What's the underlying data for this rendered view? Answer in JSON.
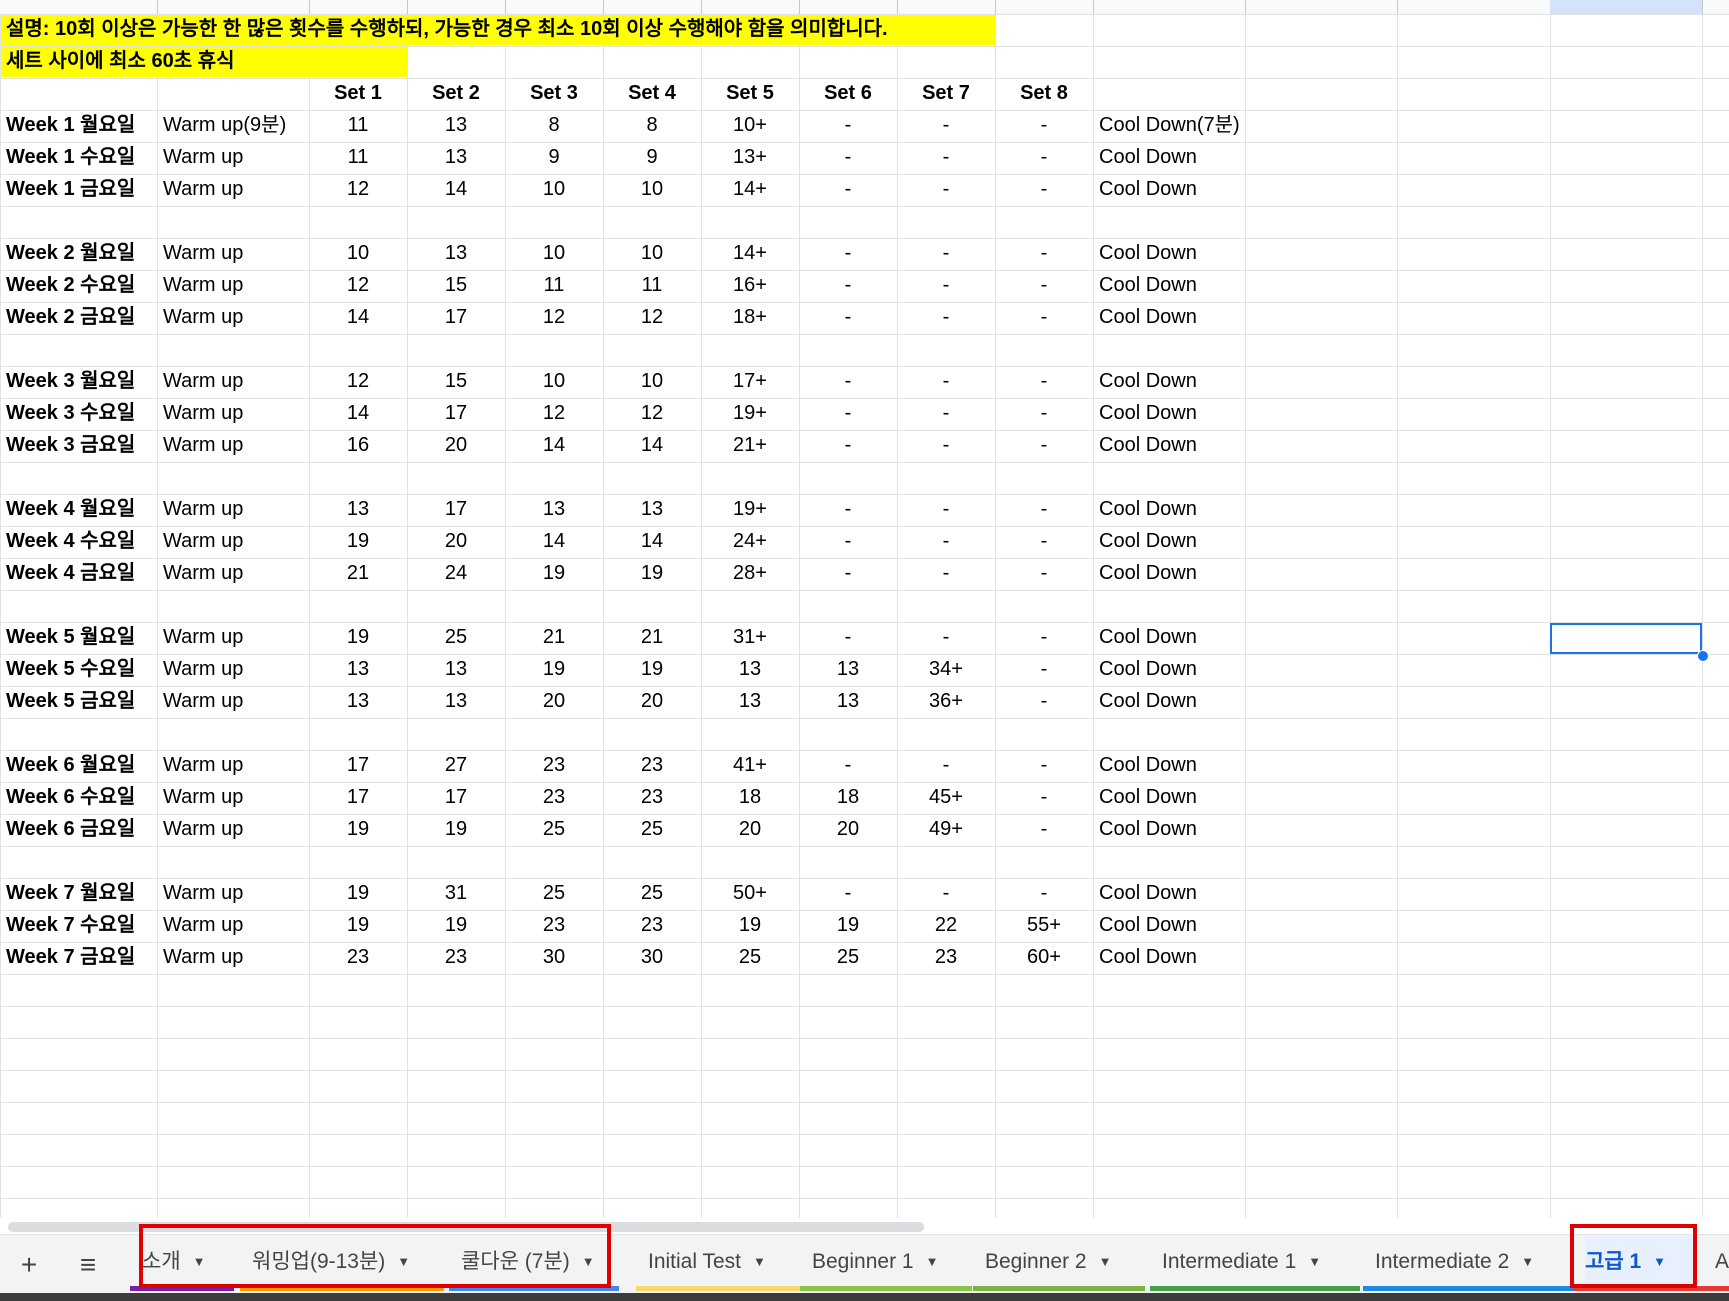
{
  "notes": {
    "line1": "설명: 10회 이상은 가능한 한 많은 횟수를 수행하되, 가능한 경우 최소 10회 이상 수행해야 함을 의미합니다.",
    "line2": "세트 사이에 최소 60초 휴식"
  },
  "headers": [
    "Set 1",
    "Set 2",
    "Set 3",
    "Set 4",
    "Set 5",
    "Set 6",
    "Set 7",
    "Set 8"
  ],
  "rows": [
    {
      "label": "Week 1 월요일",
      "warm": "Warm up(9분)",
      "sets": [
        "11",
        "13",
        "8",
        "8",
        "10+",
        "-",
        "-",
        "-"
      ],
      "cool": "Cool Down(7분)"
    },
    {
      "label": "Week 1 수요일",
      "warm": "Warm up",
      "sets": [
        "11",
        "13",
        "9",
        "9",
        "13+",
        "-",
        "-",
        "-"
      ],
      "cool": "Cool Down"
    },
    {
      "label": "Week 1 금요일",
      "warm": "Warm up",
      "sets": [
        "12",
        "14",
        "10",
        "10",
        "14+",
        "-",
        "-",
        "-"
      ],
      "cool": "Cool Down"
    },
    null,
    {
      "label": "Week 2 월요일",
      "warm": "Warm up",
      "sets": [
        "10",
        "13",
        "10",
        "10",
        "14+",
        "-",
        "-",
        "-"
      ],
      "cool": "Cool Down"
    },
    {
      "label": "Week 2 수요일",
      "warm": "Warm up",
      "sets": [
        "12",
        "15",
        "11",
        "11",
        "16+",
        "-",
        "-",
        "-"
      ],
      "cool": "Cool Down"
    },
    {
      "label": "Week 2 금요일",
      "warm": "Warm up",
      "sets": [
        "14",
        "17",
        "12",
        "12",
        "18+",
        "-",
        "-",
        "-"
      ],
      "cool": "Cool Down"
    },
    null,
    {
      "label": "Week 3 월요일",
      "warm": "Warm up",
      "sets": [
        "12",
        "15",
        "10",
        "10",
        "17+",
        "-",
        "-",
        "-"
      ],
      "cool": "Cool Down"
    },
    {
      "label": "Week 3 수요일",
      "warm": "Warm up",
      "sets": [
        "14",
        "17",
        "12",
        "12",
        "19+",
        "-",
        "-",
        "-"
      ],
      "cool": "Cool Down"
    },
    {
      "label": "Week 3 금요일",
      "warm": "Warm up",
      "sets": [
        "16",
        "20",
        "14",
        "14",
        "21+",
        "-",
        "-",
        "-"
      ],
      "cool": "Cool Down"
    },
    null,
    {
      "label": "Week 4 월요일",
      "warm": "Warm up",
      "sets": [
        "13",
        "17",
        "13",
        "13",
        "19+",
        "-",
        "-",
        "-"
      ],
      "cool": "Cool Down"
    },
    {
      "label": "Week 4 수요일",
      "warm": "Warm up",
      "sets": [
        "19",
        "20",
        "14",
        "14",
        "24+",
        "-",
        "-",
        "-"
      ],
      "cool": "Cool Down"
    },
    {
      "label": "Week 4 금요일",
      "warm": "Warm up",
      "sets": [
        "21",
        "24",
        "19",
        "19",
        "28+",
        "-",
        "-",
        "-"
      ],
      "cool": "Cool Down"
    },
    null,
    {
      "label": "Week 5 월요일",
      "warm": "Warm up",
      "sets": [
        "19",
        "25",
        "21",
        "21",
        "31+",
        "-",
        "-",
        "-"
      ],
      "cool": "Cool Down"
    },
    {
      "label": "Week 5 수요일",
      "warm": "Warm up",
      "sets": [
        "13",
        "13",
        "19",
        "19",
        "13",
        "13",
        "34+",
        "-"
      ],
      "cool": "Cool Down"
    },
    {
      "label": "Week 5 금요일",
      "warm": "Warm up",
      "sets": [
        "13",
        "13",
        "20",
        "20",
        "13",
        "13",
        "36+",
        "-"
      ],
      "cool": "Cool Down"
    },
    null,
    {
      "label": "Week 6 월요일",
      "warm": "Warm up",
      "sets": [
        "17",
        "27",
        "23",
        "23",
        "41+",
        "-",
        "-",
        "-"
      ],
      "cool": "Cool Down"
    },
    {
      "label": "Week 6 수요일",
      "warm": "Warm up",
      "sets": [
        "17",
        "17",
        "23",
        "23",
        "18",
        "18",
        "45+",
        "-"
      ],
      "cool": "Cool Down"
    },
    {
      "label": "Week 6 금요일",
      "warm": "Warm up",
      "sets": [
        "19",
        "19",
        "25",
        "25",
        "20",
        "20",
        "49+",
        "-"
      ],
      "cool": "Cool Down"
    },
    null,
    {
      "label": "Week 7 월요일",
      "warm": "Warm up",
      "sets": [
        "19",
        "31",
        "25",
        "25",
        "50+",
        "-",
        "-",
        "-"
      ],
      "cool": "Cool Down"
    },
    {
      "label": "Week 7 수요일",
      "warm": "Warm up",
      "sets": [
        "19",
        "19",
        "23",
        "23",
        "19",
        "19",
        "22",
        "55+"
      ],
      "cool": "Cool Down"
    },
    {
      "label": "Week 7 금요일",
      "warm": "Warm up",
      "sets": [
        "23",
        "23",
        "30",
        "30",
        "25",
        "25",
        "23",
        "60+"
      ],
      "cool": "Cool Down"
    }
  ],
  "tabs": [
    {
      "label": "소개",
      "color": "#7b1fa2",
      "active": false
    },
    {
      "label": "워밍업(9-13분)",
      "color": "#ff9800",
      "active": false
    },
    {
      "label": "쿨다운 (7분)",
      "color": "#4285f4",
      "active": false
    },
    {
      "label": "Initial Test",
      "color": "#f6d96b",
      "active": false
    },
    {
      "label": "Beginner 1",
      "color": "#8bc34a",
      "active": false
    },
    {
      "label": "Beginner 2",
      "color": "#7cb342",
      "active": false
    },
    {
      "label": "Intermediate 1",
      "color": "#43a047",
      "active": false
    },
    {
      "label": "Intermediate 2",
      "color": "#1e88e5",
      "active": false
    },
    {
      "label": "고급 1",
      "color": "#e53935",
      "active": true
    },
    {
      "label": "A",
      "color": "#e53935",
      "active": false
    }
  ],
  "icons": {
    "add": "plus-icon",
    "all_sheets": "hamburger-menu-icon",
    "tab_menu": "caret-down-icon"
  },
  "colors": {
    "highlight": "#ffff00",
    "selection": "#1a73e8",
    "annotation": "#e00000"
  }
}
